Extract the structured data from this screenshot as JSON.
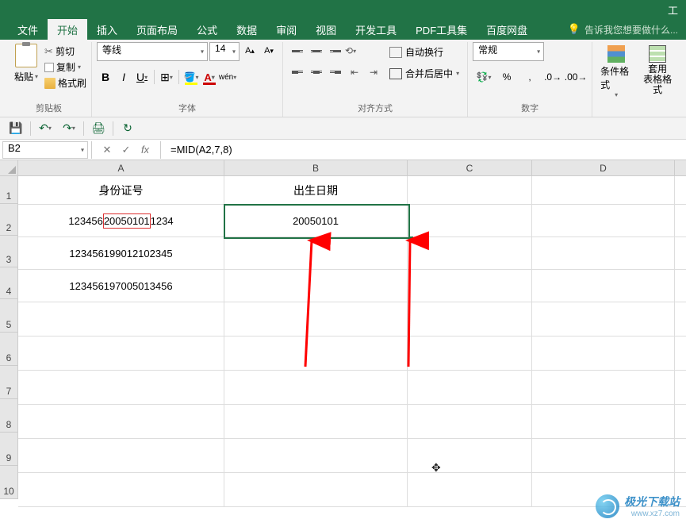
{
  "title_right": "工",
  "tabs": {
    "file": "文件",
    "home": "开始",
    "insert": "插入",
    "page_layout": "页面布局",
    "formulas": "公式",
    "data": "数据",
    "review": "审阅",
    "view": "视图",
    "developer": "开发工具",
    "pdf": "PDF工具集",
    "baidu": "百度网盘",
    "tell_me": "告诉我您想要做什么..."
  },
  "ribbon": {
    "clipboard": {
      "paste": "粘贴",
      "cut": "剪切",
      "copy": "复制",
      "format_painter": "格式刷",
      "group": "剪贴板"
    },
    "font": {
      "name": "等线",
      "size": "14",
      "bold": "B",
      "italic": "I",
      "underline": "U",
      "fill_label": "A",
      "color_label": "A",
      "wen": "wén",
      "group": "字体"
    },
    "align": {
      "wrap": "自动换行",
      "merge": "合并后居中",
      "group": "对齐方式"
    },
    "number": {
      "format": "常规",
      "group": "数字"
    },
    "styles": {
      "cond": "条件格式",
      "table": "套用\n表格格式"
    }
  },
  "formula_bar": {
    "name_box": "B2",
    "fx": "fx",
    "formula": "=MID(A2,7,8)"
  },
  "columns": {
    "A": "A",
    "B": "B",
    "C": "C",
    "D": "D"
  },
  "rows": [
    "1",
    "2",
    "3",
    "4",
    "5",
    "6",
    "7",
    "8",
    "9",
    "10"
  ],
  "cells": {
    "A1": "身份证号",
    "B1": "出生日期",
    "A2_pre": "123456",
    "A2_mid": "20050101",
    "A2_post": "1234",
    "B2": "20050101",
    "A3": "123456199012102345",
    "A4": "123456197005013456"
  },
  "watermark": {
    "name": "极光下载站",
    "url": "www.xz7.com"
  },
  "chart_data": {
    "type": "table",
    "headers": [
      "身份证号",
      "出生日期"
    ],
    "rows": [
      [
        "123456200501011234",
        "20050101"
      ],
      [
        "123456199012102345",
        ""
      ],
      [
        "123456197005013456",
        ""
      ]
    ],
    "selected_cell": "B2",
    "formula": "=MID(A2,7,8)"
  }
}
